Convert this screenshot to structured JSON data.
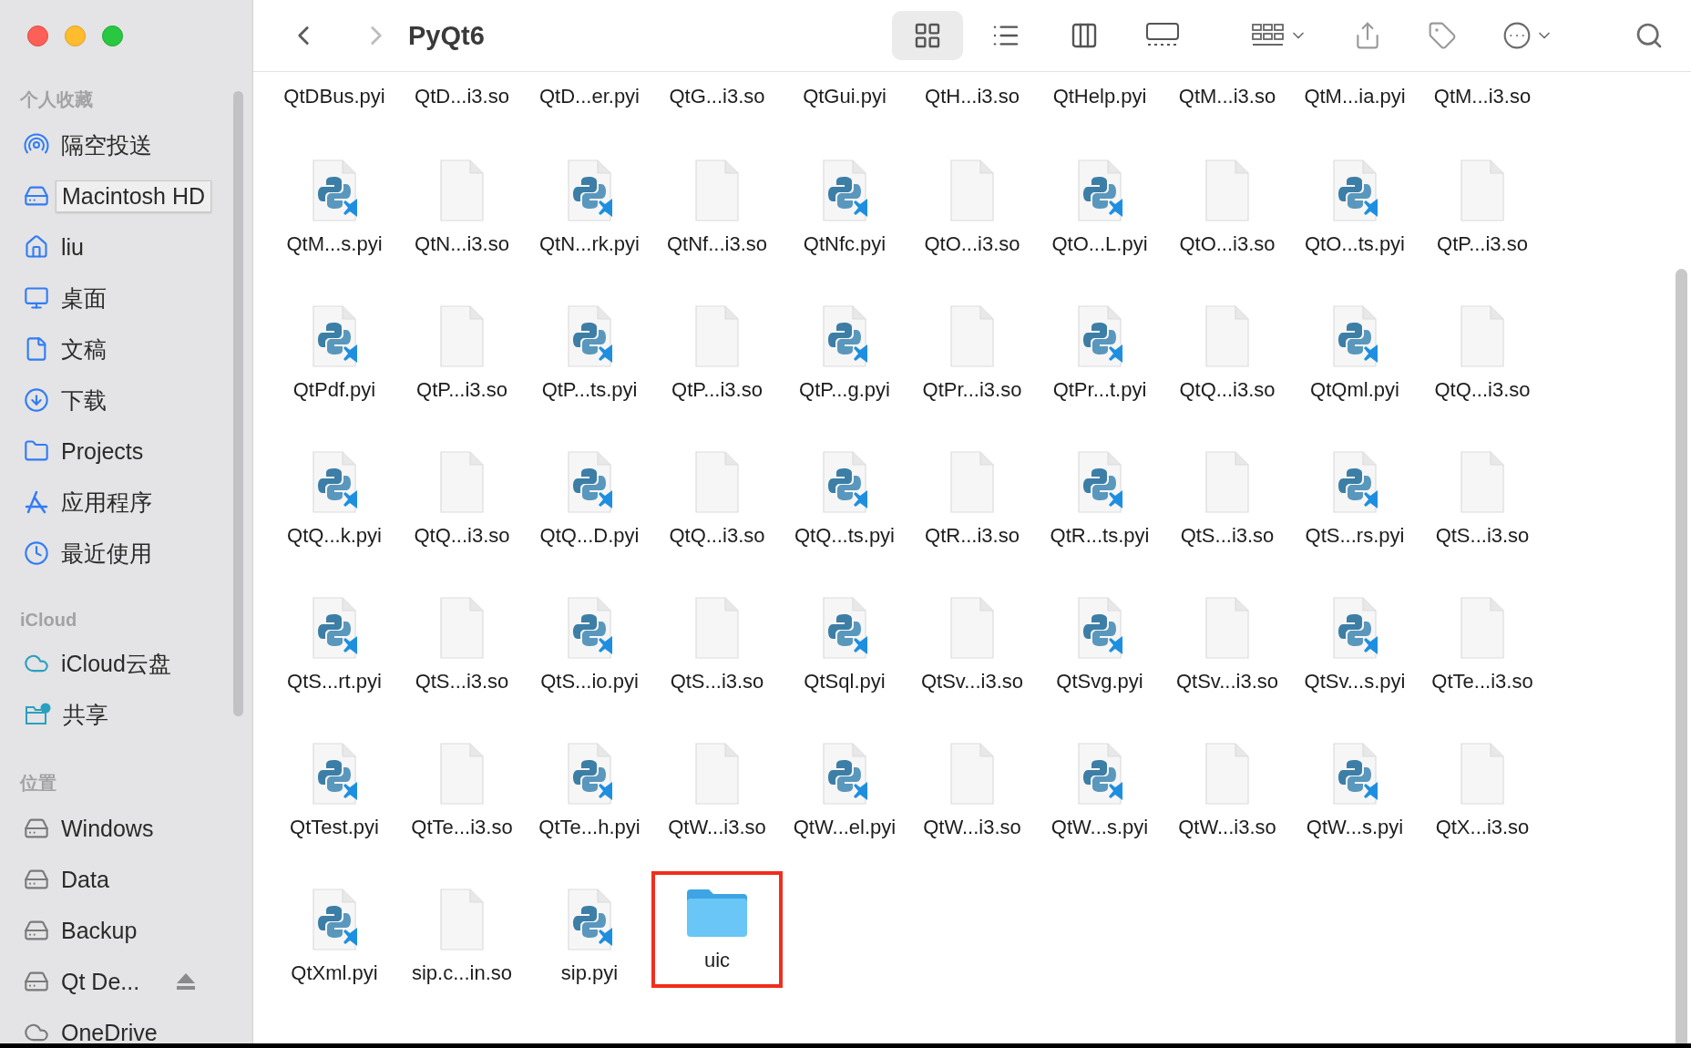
{
  "window": {
    "title": "PyQt6"
  },
  "toolbar": {
    "back_enabled": true,
    "forward_enabled": false,
    "view_modes": [
      {
        "kind": "icons",
        "selected": true
      },
      {
        "kind": "list",
        "selected": false
      },
      {
        "kind": "columns",
        "selected": false
      },
      {
        "kind": "gallery",
        "selected": false
      }
    ]
  },
  "sidebar": {
    "sections": [
      {
        "title": "个人收藏",
        "kind": "favorites",
        "items": [
          {
            "label": "隔空投送",
            "kind": "airdrop"
          },
          {
            "label": "Macintosh HD",
            "kind": "drive",
            "tooltip": true
          },
          {
            "label": "liu",
            "kind": "home"
          },
          {
            "label": "桌面",
            "kind": "desktop"
          },
          {
            "label": "文稿",
            "kind": "document"
          },
          {
            "label": "下载",
            "kind": "download"
          },
          {
            "label": "Projects",
            "kind": "folder"
          },
          {
            "label": "应用程序",
            "kind": "apps"
          },
          {
            "label": "最近使用",
            "kind": "recent"
          }
        ]
      },
      {
        "title": "iCloud",
        "kind": "icloud",
        "items": [
          {
            "label": "iCloud云盘",
            "kind": "cloud"
          },
          {
            "label": "共享",
            "kind": "shared"
          }
        ]
      },
      {
        "title": "位置",
        "kind": "locations",
        "items": [
          {
            "label": "Windows",
            "kind": "drive"
          },
          {
            "label": "Data",
            "kind": "drive"
          },
          {
            "label": "Backup",
            "kind": "drive"
          },
          {
            "label": "Qt De...",
            "kind": "drive",
            "eject": true
          },
          {
            "label": "OneDrive",
            "kind": "cloud"
          }
        ]
      }
    ]
  },
  "partial_row": [
    "QtDBus.pyi",
    "QtD...i3.so",
    "QtD...er.pyi",
    "QtG...i3.so",
    "QtGui.pyi",
    "QtH...i3.so",
    "QtHelp.pyi",
    "QtM...i3.so",
    "QtM...ia.pyi",
    "QtM...i3.so"
  ],
  "files": [
    {
      "name": "QtM...s.pyi",
      "kind": "pyi"
    },
    {
      "name": "QtN...i3.so",
      "kind": "so"
    },
    {
      "name": "QtN...rk.pyi",
      "kind": "pyi"
    },
    {
      "name": "QtNf...i3.so",
      "kind": "so"
    },
    {
      "name": "QtNfc.pyi",
      "kind": "pyi"
    },
    {
      "name": "QtO...i3.so",
      "kind": "so"
    },
    {
      "name": "QtO...L.pyi",
      "kind": "pyi"
    },
    {
      "name": "QtO...i3.so",
      "kind": "so"
    },
    {
      "name": "QtO...ts.pyi",
      "kind": "pyi"
    },
    {
      "name": "QtP...i3.so",
      "kind": "so"
    },
    {
      "name": "QtPdf.pyi",
      "kind": "pyi"
    },
    {
      "name": "QtP...i3.so",
      "kind": "so"
    },
    {
      "name": "QtP...ts.pyi",
      "kind": "pyi"
    },
    {
      "name": "QtP...i3.so",
      "kind": "so"
    },
    {
      "name": "QtP...g.pyi",
      "kind": "pyi"
    },
    {
      "name": "QtPr...i3.so",
      "kind": "so"
    },
    {
      "name": "QtPr...t.pyi",
      "kind": "pyi"
    },
    {
      "name": "QtQ...i3.so",
      "kind": "so"
    },
    {
      "name": "QtQml.pyi",
      "kind": "pyi"
    },
    {
      "name": "QtQ...i3.so",
      "kind": "so"
    },
    {
      "name": "QtQ...k.pyi",
      "kind": "pyi"
    },
    {
      "name": "QtQ...i3.so",
      "kind": "so"
    },
    {
      "name": "QtQ...D.pyi",
      "kind": "pyi"
    },
    {
      "name": "QtQ...i3.so",
      "kind": "so"
    },
    {
      "name": "QtQ...ts.pyi",
      "kind": "pyi"
    },
    {
      "name": "QtR...i3.so",
      "kind": "so"
    },
    {
      "name": "QtR...ts.pyi",
      "kind": "pyi"
    },
    {
      "name": "QtS...i3.so",
      "kind": "so"
    },
    {
      "name": "QtS...rs.pyi",
      "kind": "pyi"
    },
    {
      "name": "QtS...i3.so",
      "kind": "so"
    },
    {
      "name": "QtS...rt.pyi",
      "kind": "pyi"
    },
    {
      "name": "QtS...i3.so",
      "kind": "so"
    },
    {
      "name": "QtS...io.pyi",
      "kind": "pyi"
    },
    {
      "name": "QtS...i3.so",
      "kind": "so"
    },
    {
      "name": "QtSql.pyi",
      "kind": "pyi"
    },
    {
      "name": "QtSv...i3.so",
      "kind": "so"
    },
    {
      "name": "QtSvg.pyi",
      "kind": "pyi"
    },
    {
      "name": "QtSv...i3.so",
      "kind": "so"
    },
    {
      "name": "QtSv...s.pyi",
      "kind": "pyi"
    },
    {
      "name": "QtTe...i3.so",
      "kind": "so"
    },
    {
      "name": "QtTest.pyi",
      "kind": "pyi"
    },
    {
      "name": "QtTe...i3.so",
      "kind": "so"
    },
    {
      "name": "QtTe...h.pyi",
      "kind": "pyi"
    },
    {
      "name": "QtW...i3.so",
      "kind": "so"
    },
    {
      "name": "QtW...el.pyi",
      "kind": "pyi"
    },
    {
      "name": "QtW...i3.so",
      "kind": "so"
    },
    {
      "name": "QtW...s.pyi",
      "kind": "pyi"
    },
    {
      "name": "QtW...i3.so",
      "kind": "so"
    },
    {
      "name": "QtW...s.pyi",
      "kind": "pyi"
    },
    {
      "name": "QtX...i3.so",
      "kind": "so"
    },
    {
      "name": "QtXml.pyi",
      "kind": "pyi"
    },
    {
      "name": "sip.c...in.so",
      "kind": "so"
    },
    {
      "name": "sip.pyi",
      "kind": "pyi"
    },
    {
      "name": "uic",
      "kind": "folder",
      "highlighted": true
    }
  ]
}
